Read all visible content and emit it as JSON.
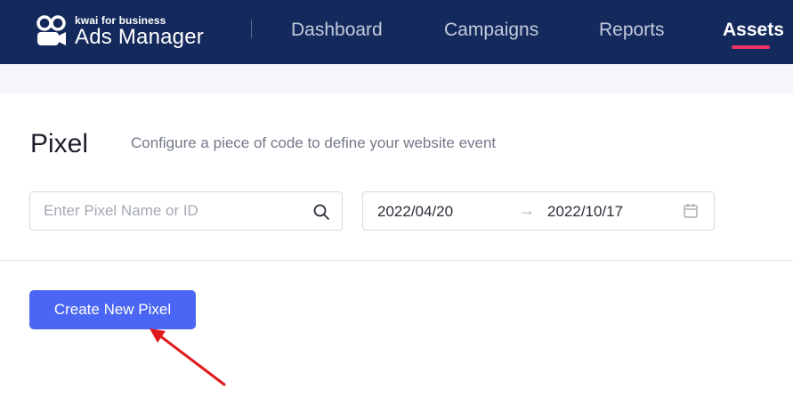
{
  "header": {
    "logo_sub": "kwai for business",
    "logo_main": "Ads Manager",
    "nav": [
      {
        "label": "Dashboard",
        "active": false
      },
      {
        "label": "Campaigns",
        "active": false
      },
      {
        "label": "Reports",
        "active": false
      },
      {
        "label": "Assets",
        "active": true
      }
    ],
    "active_color": "#f0346a",
    "background": "#142a5c"
  },
  "page": {
    "title": "Pixel",
    "subtitle": "Configure a piece of code to define your website event"
  },
  "filters": {
    "search": {
      "placeholder": "Enter Pixel Name or ID",
      "value": "",
      "icon": "search-icon"
    },
    "date_range": {
      "start": "2022/04/20",
      "separator": "→",
      "end": "2022/10/17",
      "icon": "calendar-icon"
    }
  },
  "actions": {
    "create_label": "Create New Pixel",
    "create_color": "#4a66f2"
  },
  "annotation": {
    "arrow_color": "#e0191d",
    "arrow_icon": "pointer-arrow-icon"
  }
}
